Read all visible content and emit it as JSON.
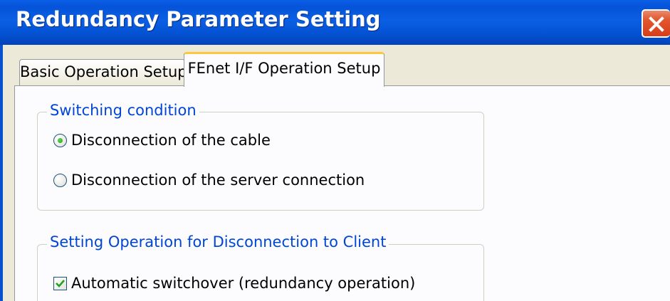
{
  "window": {
    "title": "Redundancy Parameter Setting"
  },
  "tabs": [
    {
      "label": "Basic Operation Setup",
      "selected": false
    },
    {
      "label": "FEnet I/F Operation Setup",
      "selected": true
    }
  ],
  "switching_condition": {
    "legend": "Switching condition",
    "options": [
      {
        "label": "Disconnection of the cable",
        "selected": true
      },
      {
        "label": "Disconnection of the server connection",
        "selected": false
      }
    ]
  },
  "client_disconnection": {
    "legend": "Setting Operation for Disconnection to Client",
    "checkbox": {
      "label": "Automatic switchover (redundancy operation)",
      "checked": true
    }
  },
  "icons": {
    "close": "close-icon",
    "radio_selected": "radio-selected-icon",
    "checkmark": "checkmark-icon"
  },
  "colors": {
    "titlebar": "#0553d8",
    "close_button": "#e2572f",
    "legend_text": "#0046d5",
    "active_tab_highlight": "#ffc83c",
    "window_bg": "#ece9d8"
  }
}
